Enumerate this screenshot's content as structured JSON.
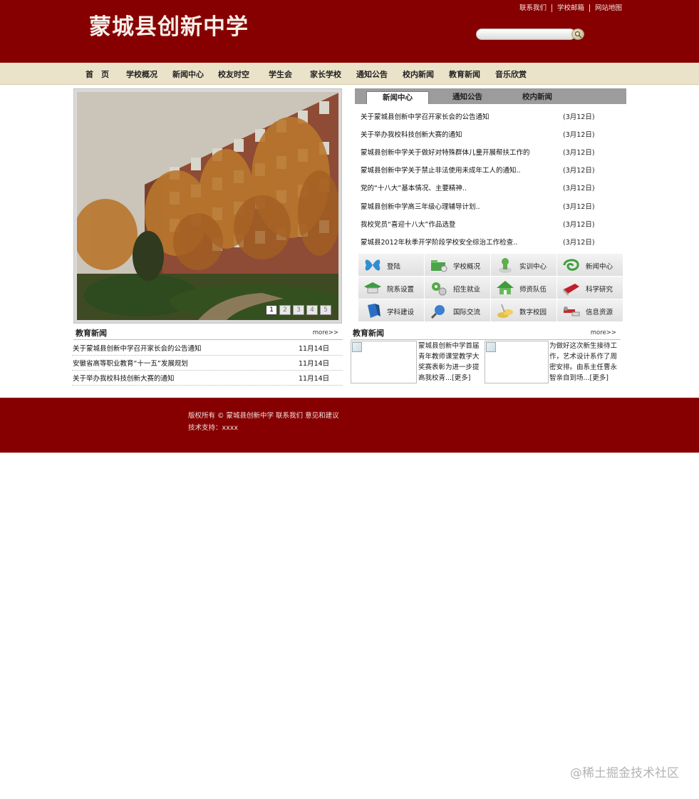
{
  "site": {
    "title": "蒙城县创新中学"
  },
  "top_links": [
    "联系我们",
    "学校邮箱",
    "网站地图"
  ],
  "search": {
    "placeholder": ""
  },
  "nav": [
    "首　页",
    "学校概况",
    "新闻中心",
    "校友时空",
    "学生会",
    "家长学校",
    "通知公告",
    "校内新闻",
    "教育新闻",
    "音乐欣赏"
  ],
  "slideshow": {
    "pages": [
      "1",
      "2",
      "3",
      "4",
      "5"
    ],
    "active_page": "1"
  },
  "news_tabs": {
    "tabs": [
      "新闻中心",
      "通知公告",
      "校内新闻"
    ],
    "active": "新闻中心",
    "items": [
      {
        "title": "关于蒙城县创新中学召开家长会的公告通知",
        "date": "(3月12日)"
      },
      {
        "title": "关于举办我校科技创新大赛的通知",
        "date": "(3月12日)"
      },
      {
        "title": "蒙城县创新中学关于做好对特殊群体儿童开展帮扶工作的",
        "date": "(3月12日)"
      },
      {
        "title": "蒙城县创新中学关于禁止非法使用未成年工人的通知..",
        "date": "(3月12日)"
      },
      {
        "title": "党的“十八大”基本情况、主要精神..",
        "date": "(3月12日)"
      },
      {
        "title": "蒙城县创新中学高三年级心理辅导计划..",
        "date": "(3月12日)"
      },
      {
        "title": "我校党员“喜迎十八大”作品选登",
        "date": "(3月12日)"
      },
      {
        "title": "蒙城县2012年秋季开学阶段学校安全综治工作检查..",
        "date": "(3月12日)"
      }
    ]
  },
  "quick_links": [
    {
      "label": "登陆",
      "icon": "butterfly-icon"
    },
    {
      "label": "学校概况",
      "icon": "folder-icon"
    },
    {
      "label": "实训中心",
      "icon": "user-icon"
    },
    {
      "label": "新闻中心",
      "icon": "swirl-icon"
    },
    {
      "label": "院系设置",
      "icon": "cap-icon"
    },
    {
      "label": "招生就业",
      "icon": "gears-icon"
    },
    {
      "label": "师资队伍",
      "icon": "house-icon"
    },
    {
      "label": "科学研究",
      "icon": "book-icon"
    },
    {
      "label": "学科建设",
      "icon": "pen-icon"
    },
    {
      "label": "国际交流",
      "icon": "magnifier-icon"
    },
    {
      "label": "数字校园",
      "icon": "coins-icon"
    },
    {
      "label": "信息资源",
      "icon": "tools-icon"
    }
  ],
  "edu_news_left": {
    "title": "教育新闻",
    "more": "more>>",
    "items": [
      {
        "title": "关于蒙城县创新中学召开家长会的公告通知",
        "date": "11月14日"
      },
      {
        "title": "安徽省高等职业教育“十一五”发展规划",
        "date": "11月14日"
      },
      {
        "title": "关于举办我校科技创新大赛的通知",
        "date": "11月14日"
      }
    ]
  },
  "edu_news_right": {
    "title": "教育新闻",
    "more": "more>>",
    "items": [
      {
        "text": "蒙城县创新中学首届青年教师课堂教学大奖赛表彰为进一步提高我校青...[更多]"
      },
      {
        "text": "为做好这次新生接待工作，艺术设计系作了周密安排。由系主任曹永智亲自到场...[更多]"
      }
    ]
  },
  "footer": {
    "line1": "版权所有 © 蒙城县创新中学 联系我们 意见和建议",
    "line2": "技术支持：xxxx"
  },
  "watermark": "@稀土掘金技术社区",
  "colors": {
    "brand": "#870001",
    "nav_bg": "#ebe3c9",
    "tab_bar": "#9c9c9c"
  }
}
